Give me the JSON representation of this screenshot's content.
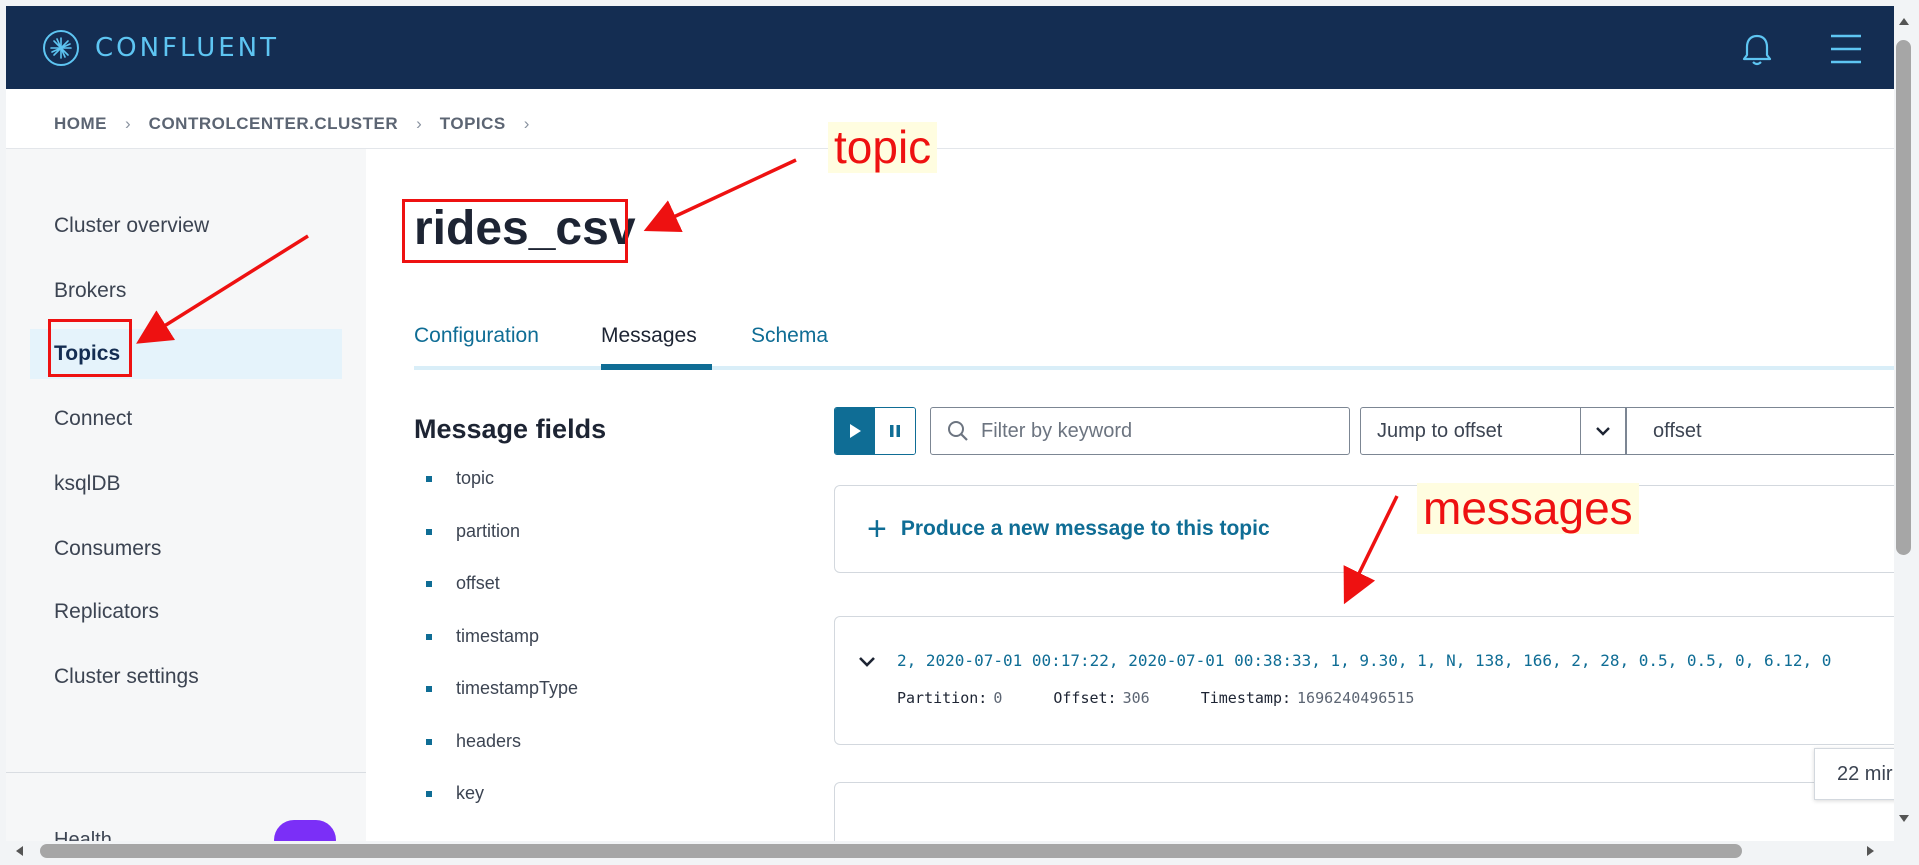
{
  "app": {
    "brand": "CONFLUENT"
  },
  "breadcrumb": [
    "HOME",
    "CONTROLCENTER.CLUSTER",
    "TOPICS"
  ],
  "sidebar": {
    "items": [
      {
        "label": "Cluster overview",
        "active": false
      },
      {
        "label": "Brokers",
        "active": false
      },
      {
        "label": "Topics",
        "active": true
      },
      {
        "label": "Connect",
        "active": false
      },
      {
        "label": "ksqlDB",
        "active": false
      },
      {
        "label": "Consumers",
        "active": false
      },
      {
        "label": "Replicators",
        "active": false
      },
      {
        "label": "Cluster settings",
        "active": false
      }
    ],
    "health_label": "Health"
  },
  "topic": {
    "name": "rides_csv"
  },
  "tabs": [
    {
      "label": "Configuration",
      "active": false
    },
    {
      "label": "Messages",
      "active": true
    },
    {
      "label": "Schema",
      "active": false
    }
  ],
  "message_fields": {
    "title": "Message fields",
    "fields": [
      "topic",
      "partition",
      "offset",
      "timestamp",
      "timestampType",
      "headers",
      "key"
    ]
  },
  "controls": {
    "filter_placeholder": "Filter by keyword",
    "jump_label": "Jump to offset",
    "offset_placeholder": "offset"
  },
  "produce": {
    "label": "Produce a new message to this topic"
  },
  "messages": [
    {
      "value": "2, 2020-07-01 00:17:22, 2020-07-01 00:38:33, 1, 9.30, 1, N, 138, 166, 2, 28, 0.5, 0.5, 0, 6.12, 0",
      "partition_label": "Partition:",
      "partition": "0",
      "offset_label": "Offset:",
      "offset": "306",
      "timestamp_label": "Timestamp:",
      "timestamp": "1696240496515"
    }
  ],
  "tooltip": {
    "text": "22 mir"
  },
  "annotations": {
    "topic": "topic",
    "messages": "messages"
  },
  "colors": {
    "topbar": "#142d52",
    "brand": "#5ec5f2",
    "accent": "#0f6d95",
    "annotation": "#ee1111",
    "active_nav_bg": "#e5f3fb"
  }
}
